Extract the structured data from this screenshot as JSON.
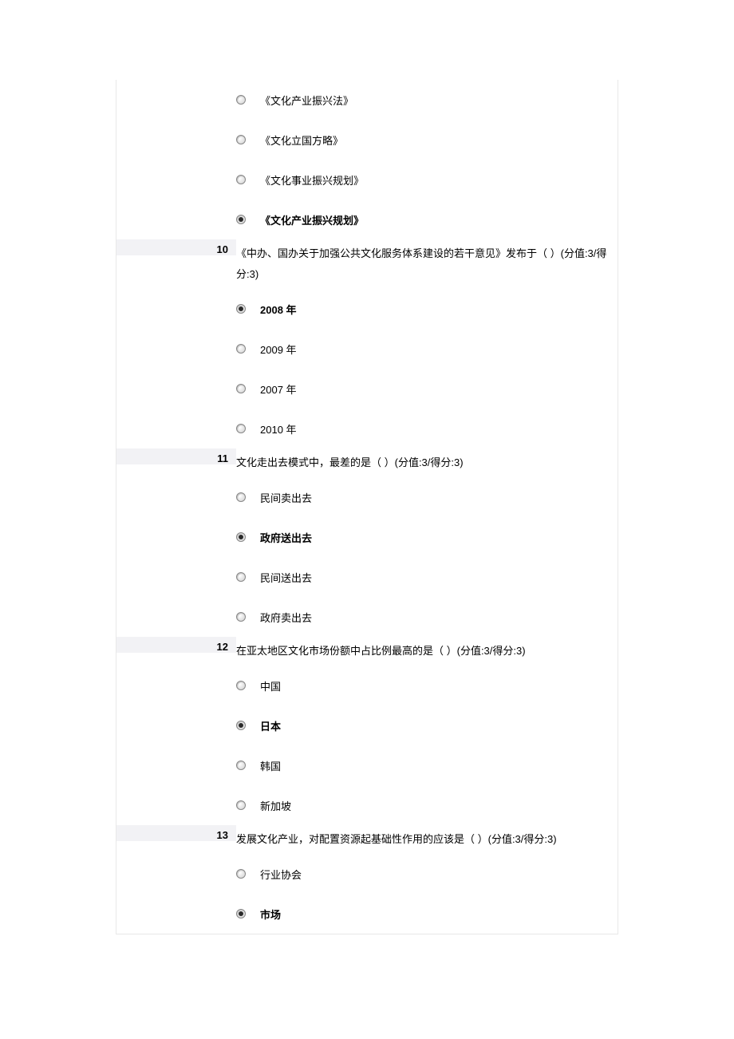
{
  "orphan_options": [
    {
      "label": "《文化产业振兴法》",
      "selected": false,
      "bold": false
    },
    {
      "label": "《文化立国方略》",
      "selected": false,
      "bold": false
    },
    {
      "label": "《文化事业振兴规划》",
      "selected": false,
      "bold": false
    },
    {
      "label": "《文化产业振兴规划》",
      "selected": true,
      "bold": true
    }
  ],
  "questions": [
    {
      "number": "10",
      "text": "《中办、国办关于加强公共文化服务体系建设的若干意见》发布于（ ）(分值:3/得分:3)",
      "options": [
        {
          "label": "2008 年",
          "selected": true,
          "bold": true,
          "arial": true
        },
        {
          "label": "2009 年",
          "selected": false,
          "bold": false,
          "arial": true
        },
        {
          "label": "2007 年",
          "selected": false,
          "bold": false,
          "arial": true
        },
        {
          "label": "2010 年",
          "selected": false,
          "bold": false,
          "arial": true
        }
      ]
    },
    {
      "number": "11",
      "text": "文化走出去模式中，最差的是（ ）(分值:3/得分:3)",
      "options": [
        {
          "label": "民间卖出去",
          "selected": false,
          "bold": false
        },
        {
          "label": "政府送出去",
          "selected": true,
          "bold": true
        },
        {
          "label": "民间送出去",
          "selected": false,
          "bold": false
        },
        {
          "label": "政府卖出去",
          "selected": false,
          "bold": false
        }
      ]
    },
    {
      "number": "12",
      "text": "在亚太地区文化市场份额中占比例最高的是（ ）(分值:3/得分:3)",
      "options": [
        {
          "label": "中国",
          "selected": false,
          "bold": false
        },
        {
          "label": "日本",
          "selected": true,
          "bold": true
        },
        {
          "label": "韩国",
          "selected": false,
          "bold": false
        },
        {
          "label": "新加坡",
          "selected": false,
          "bold": false
        }
      ]
    },
    {
      "number": "13",
      "text": "发展文化产业，对配置资源起基础性作用的应该是（ ）(分值:3/得分:3)",
      "options": [
        {
          "label": "行业协会",
          "selected": false,
          "bold": false
        },
        {
          "label": "市场",
          "selected": true,
          "bold": true
        }
      ]
    }
  ]
}
